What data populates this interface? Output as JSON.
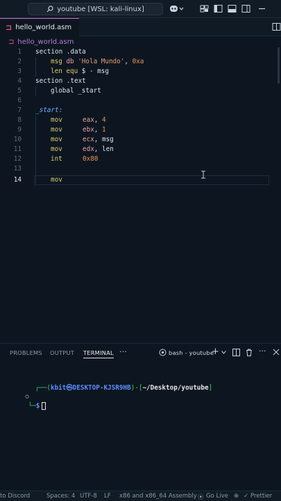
{
  "titlebar": {
    "search_text": "youtube [WSL: kali-linux]",
    "icons": [
      "search-icon",
      "copilot-icon",
      "toggle-primary-sidebar-icon",
      "toggle-panel-icon",
      "toggle-secondary-sidebar-icon",
      "customize-layout-icon"
    ]
  },
  "tab": {
    "label": "hello_world.asm",
    "modified": true
  },
  "breadcrumb": {
    "file": "hello_world.asm"
  },
  "editor": {
    "lines": [
      {
        "n": "1"
      },
      {
        "n": "2"
      },
      {
        "n": "3"
      },
      {
        "n": "4"
      },
      {
        "n": "5"
      },
      {
        "n": "6"
      },
      {
        "n": "7"
      },
      {
        "n": "8"
      },
      {
        "n": "9"
      },
      {
        "n": "10"
      },
      {
        "n": "11"
      },
      {
        "n": "12"
      },
      {
        "n": "13"
      },
      {
        "n": "14"
      }
    ],
    "code": {
      "l1_a": "section",
      "l1_b": " .data",
      "l2_a": "msg",
      "l2_b": " db ",
      "l2_c": "'Hola Mundo'",
      "l2_d": ", ",
      "l2_e": "0xa",
      "l3_a": "len",
      "l3_b": " equ ",
      "l3_c": "$ - msg",
      "l4_a": "section",
      "l4_b": " .text",
      "l5_a": "global",
      "l5_b": " _start",
      "l7": "_start:",
      "l8_a": "mov",
      "l8_b": "eax",
      "l8_c": ", ",
      "l8_d": "4",
      "l9_a": "mov",
      "l9_b": "ebx",
      "l9_c": ", ",
      "l9_d": "1",
      "l10_a": "mov",
      "l10_b": "ecx",
      "l10_c": ", msg",
      "l11_a": "mov",
      "l11_b": "edx",
      "l11_c": ", len",
      "l12_a": "int",
      "l12_b": "0x80",
      "l14": "mov"
    }
  },
  "panel": {
    "tabs": [
      "PROBLEMS",
      "OUTPUT",
      "TERMINAL"
    ],
    "active_tab": "TERMINAL",
    "more": "···",
    "terminal_name": "bash - youtube",
    "terminal_lines": {
      "l1_a": "┌──(",
      "l1_b": "kbit㉿DESKTOP-KJSR9HB",
      "l1_c": ")-[",
      "l1_d": "~/Desktop/youtube",
      "l1_e": "]",
      "l2_a": "└─",
      "l2_b": "$"
    }
  },
  "statusbar": {
    "discord": "to Discord",
    "spaces": "Spaces: 4",
    "encoding": "UTF-8",
    "eol": "LF",
    "language": "x86 and x86_64 Assembly",
    "golive": "Go Live",
    "prettier": "Prettier"
  },
  "colors": {
    "background": "#0d1620",
    "tab_accent": "#d36dd0",
    "terminal_green": "#3fcf5f",
    "terminal_blue": "#5b8cff"
  }
}
